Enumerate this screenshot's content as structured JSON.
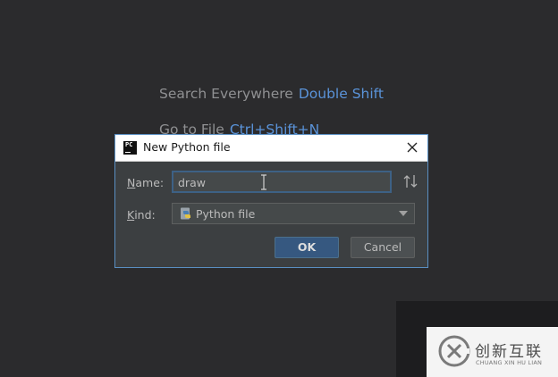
{
  "hints": [
    {
      "label": "Search Everywhere",
      "shortcut": "Double Shift"
    },
    {
      "label": "Go to File",
      "shortcut": "Ctrl+Shift+N"
    }
  ],
  "dialog": {
    "app_icon_text": "PC",
    "title": "New Python file",
    "name_label_mnemonic": "N",
    "name_label_rest": "ame:",
    "name_value": "draw",
    "kind_label_mnemonic": "K",
    "kind_label_rest": "ind:",
    "kind_value": "Python file",
    "ok_label": "OK",
    "cancel_label": "Cancel"
  },
  "watermark": {
    "text": "创新互联",
    "subtext": "CHUANG XIN HU LIAN"
  },
  "colors": {
    "background": "#2b2b2d",
    "hint_text": "#8f9092",
    "shortcut": "#5a93d9",
    "dialog_bg": "#3c3f41",
    "ok_button": "#365880"
  },
  "icons": [
    "pycharm-app-icon",
    "close-icon",
    "text-cursor-icon",
    "sort-icon",
    "python-file-icon",
    "chevron-down-icon",
    "watermark-logo-icon"
  ]
}
